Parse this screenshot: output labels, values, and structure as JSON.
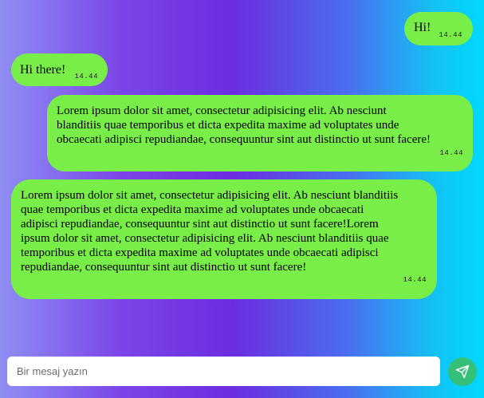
{
  "messages": [
    {
      "direction": "sent",
      "text": "Hi!",
      "time": "14.44"
    },
    {
      "direction": "received",
      "text": "Hi there!",
      "time": "14.44"
    },
    {
      "direction": "sent",
      "text": "Lorem ipsum dolor sit amet, consectetur adipisicing elit. Ab nesciunt blanditiis quae temporibus et dicta expedita maxime ad voluptates unde obcaecati adipisci repudiandae, consequuntur sint aut distinctio ut sunt facere!",
      "time": "14.44"
    },
    {
      "direction": "received",
      "text": "Lorem ipsum dolor sit amet, consectetur adipisicing elit. Ab nesciunt blanditiis quae temporibus et dicta expedita maxime ad voluptates unde obcaecati adipisci repudiandae, consequuntur sint aut distinctio ut sunt facere!Lorem ipsum dolor sit amet, consectetur adipisicing elit. Ab nesciunt blanditiis quae temporibus et dicta expedita maxime ad voluptates unde obcaecati adipisci repudiandae, consequuntur sint aut distinctio ut sunt facere!",
      "time": "14.44"
    }
  ],
  "composer": {
    "placeholder": "Bir mesaj yazın",
    "value": ""
  },
  "send_button": {
    "icon": "paper-plane-icon"
  },
  "colors": {
    "bubble": "#79ee48",
    "send_button": "#35c07a",
    "gradient_left": "#8f8ef3",
    "gradient_middle": "#6c2de0",
    "gradient_right": "#00d9ff"
  }
}
